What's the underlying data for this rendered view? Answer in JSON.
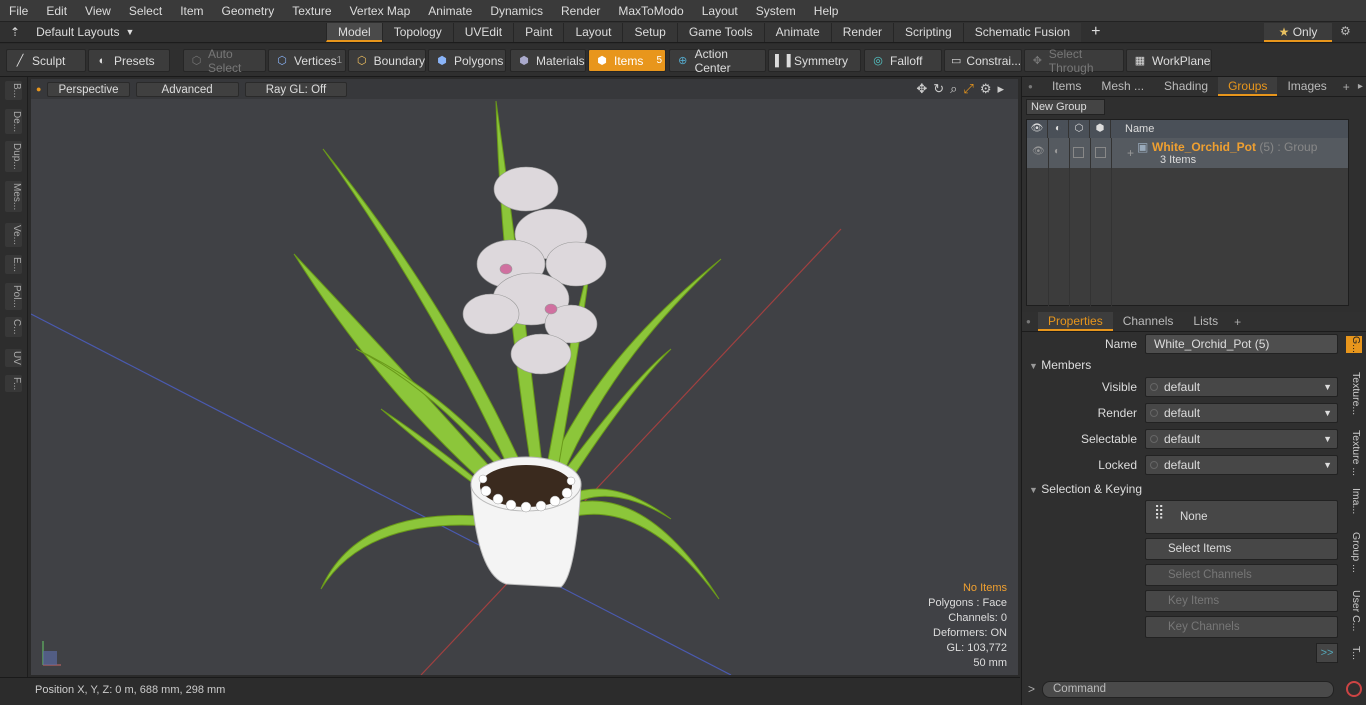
{
  "menu": [
    "File",
    "Edit",
    "View",
    "Select",
    "Item",
    "Geometry",
    "Texture",
    "Vertex Map",
    "Animate",
    "Dynamics",
    "Render",
    "MaxToModo",
    "Layout",
    "System",
    "Help"
  ],
  "layouts": {
    "label": "Default Layouts"
  },
  "mode_tabs": [
    "Model",
    "Topology",
    "UVEdit",
    "Paint",
    "Layout",
    "Setup",
    "Game Tools",
    "Animate",
    "Render",
    "Scripting",
    "Schematic Fusion"
  ],
  "only_label": "Only",
  "toolbar": {
    "sculpt": "Sculpt",
    "presets": "Presets",
    "auto_select": "Auto Select",
    "vertices": "Vertices",
    "vertices_count": "1",
    "boundary": "Boundary",
    "polygons": "Polygons",
    "materials": "Materials",
    "items": "Items",
    "items_count": "5",
    "action_center": "Action Center",
    "symmetry": "Symmetry",
    "falloff": "Falloff",
    "constraints": "Constrai...",
    "select_through": "Select Through",
    "workplane": "WorkPlane"
  },
  "left_tabs": [
    "B...",
    "De...",
    "Dup...",
    "Mes...",
    "Ve...",
    "E...",
    "Pol...",
    "C...",
    "UV",
    "F..."
  ],
  "viewport": {
    "perspective": "Perspective",
    "advanced": "Advanced",
    "raygl": "Ray GL: Off",
    "stats": {
      "items": "No Items",
      "polygons": "Polygons : Face",
      "channels": "Channels: 0",
      "deformers": "Deformers: ON",
      "gl": "GL: 103,772",
      "scale": "50 mm"
    }
  },
  "status": {
    "position": "Position X, Y, Z:   0 m, 688 mm, 298 mm"
  },
  "top_tabs": [
    "Items",
    "Mesh ...",
    "Shading",
    "Groups",
    "Images"
  ],
  "groups": {
    "new_group": "New Group",
    "col_name": "Name",
    "row": {
      "name": "White_Orchid_Pot",
      "count": "(5)",
      "type": ": Group",
      "sub": "3 Items"
    }
  },
  "prop_tabs": [
    "Properties",
    "Channels",
    "Lists"
  ],
  "properties": {
    "name_label": "Name",
    "name_value": "White_Orchid_Pot (5)",
    "members": "Members",
    "fields": [
      {
        "label": "Visible",
        "value": "default"
      },
      {
        "label": "Render",
        "value": "default"
      },
      {
        "label": "Selectable",
        "value": "default"
      },
      {
        "label": "Locked",
        "value": "default"
      }
    ],
    "sel_keying": "Selection & Keying",
    "none": "None",
    "select_items": "Select Items",
    "select_channels": "Select Channels",
    "key_items": "Key Items",
    "key_channels": "Key Channels",
    "more": ">>"
  },
  "side_tabs": [
    "G...",
    "Texture...",
    "Texture ...",
    "Ima...",
    "Group ...",
    "User C...",
    "T..."
  ],
  "command": {
    "placeholder": "Command",
    "prompt": ">"
  }
}
